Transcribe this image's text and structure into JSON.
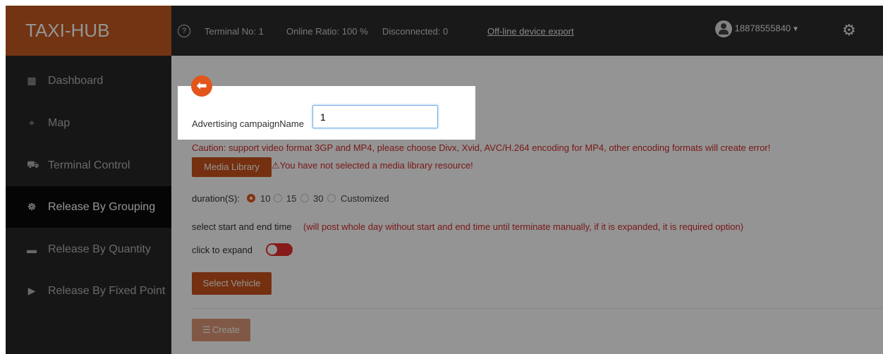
{
  "header": {
    "brand": "TAXI-HUB",
    "help_icon": "question-circle-icon",
    "terminal_no": "Terminal No:  1",
    "online_ratio": "Online Ratio:  100 %",
    "disconnected": "Disconnected:  0",
    "export_link": "Off-line device export",
    "username": "18878555840",
    "settings_icon": "gear-icon"
  },
  "sidebar": {
    "items": [
      {
        "label": "Dashboard",
        "icon": "dashboard-icon",
        "active": false
      },
      {
        "label": "Map",
        "icon": "map-icon",
        "active": false
      },
      {
        "label": "Terminal Control",
        "icon": "car-icon",
        "active": false
      },
      {
        "label": "Release By Grouping",
        "icon": "grouping-icon",
        "active": true
      },
      {
        "label": "Release By Quantity",
        "icon": "keyboard-icon",
        "active": false
      },
      {
        "label": "Release By Fixed Point",
        "icon": "play-icon",
        "active": false
      }
    ]
  },
  "form": {
    "campaign_label": "Advertising campaignName",
    "campaign_value": "1",
    "caution": "Caution:  support video format 3GP and MP4, please choose Divx, Xvid, AVC/H.264 encoding for MP4, other encoding formats will create error!",
    "media_button": "Media Library",
    "media_warning": "You have not selected a media library resource!",
    "duration_label": "duration(S):",
    "duration_options": [
      "10",
      "15",
      "30",
      "Customized"
    ],
    "duration_selected": "10",
    "time_label": "select start and end time",
    "time_note": "(will post whole day without start and end time until terminate manually, if it is expanded, it is required option)",
    "expand_label": "click to expand",
    "vehicle_button": "Select Vehicle",
    "create_button": "Create"
  },
  "colors": {
    "brand": "#c45a22",
    "accent": "#e2561b",
    "button": "#c9541d",
    "warning_text": "#d12a2a",
    "header_bg": "#2b2b2b",
    "sidebar_bg": "#262626"
  }
}
